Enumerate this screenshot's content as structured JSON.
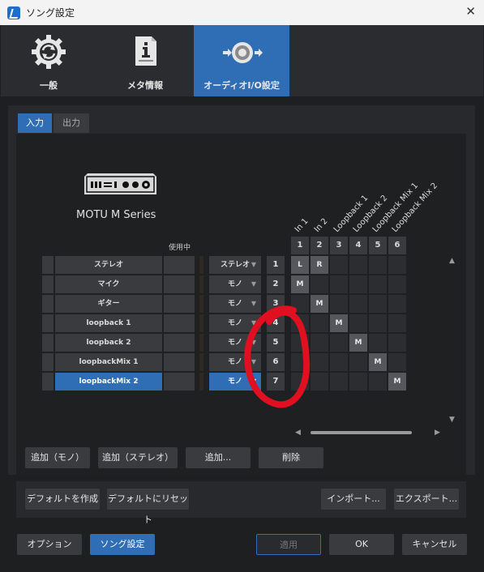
{
  "window": {
    "title": "ソング設定",
    "close_glyph": "✕"
  },
  "top_tabs": [
    {
      "label": "一般",
      "icon": "gear-refresh-icon"
    },
    {
      "label": "メタ情報",
      "icon": "info-document-icon"
    },
    {
      "label": "オーディオI/O設定",
      "icon": "audio-io-icon",
      "active": true
    }
  ],
  "sub_tabs": {
    "input": "入力",
    "output": "出力"
  },
  "device": {
    "name": "MOTU M Series",
    "icon": "audio-interface-icon"
  },
  "in_use_label": "使用中",
  "columns": [
    {
      "num": "1",
      "label": "In 1"
    },
    {
      "num": "2",
      "label": "In 2"
    },
    {
      "num": "3",
      "label": "Loopback 1"
    },
    {
      "num": "4",
      "label": "Loopback 2"
    },
    {
      "num": "5",
      "label": "Loopback Mix 1"
    },
    {
      "num": "6",
      "label": "Loopback Mix 2"
    }
  ],
  "rows": [
    {
      "name": "ステレオ",
      "format": "ステレオ",
      "num": "1"
    },
    {
      "name": "マイク",
      "format": "モノ",
      "num": "2"
    },
    {
      "name": "ギター",
      "format": "モノ",
      "num": "3"
    },
    {
      "name": "loopback 1",
      "format": "モノ",
      "num": "4"
    },
    {
      "name": "loopback 2",
      "format": "モノ",
      "num": "5"
    },
    {
      "name": "loopbackMix 1",
      "format": "モノ",
      "num": "6"
    },
    {
      "name": "loopbackMix 2",
      "format": "モノ",
      "num": "7",
      "selected": true
    }
  ],
  "matrix": [
    [
      "L",
      "R",
      "",
      "",
      "",
      ""
    ],
    [
      "M",
      "",
      "",
      "",
      "",
      ""
    ],
    [
      "",
      "M",
      "",
      "",
      "",
      ""
    ],
    [
      "",
      "",
      "M",
      "",
      "",
      ""
    ],
    [
      "",
      "",
      "",
      "M",
      "",
      ""
    ],
    [
      "",
      "",
      "",
      "",
      "M",
      ""
    ],
    [
      "",
      "",
      "",
      "",
      "",
      "M"
    ]
  ],
  "channel_buttons": {
    "add_mono": "追加（モノ）",
    "add_stereo": "追加（ステレオ）",
    "add": "追加...",
    "delete": "削除"
  },
  "default_buttons": {
    "make_default": "デフォルトを作成",
    "reset_default": "デフォルトにリセット",
    "import": "インポート...",
    "export": "エクスポート..."
  },
  "footer": {
    "options": "オプション",
    "song_settings": "ソング設定",
    "apply": "適用",
    "ok": "OK",
    "cancel": "キャンセル"
  },
  "colors": {
    "accent": "#2f6db5",
    "annotation": "#e01020"
  }
}
